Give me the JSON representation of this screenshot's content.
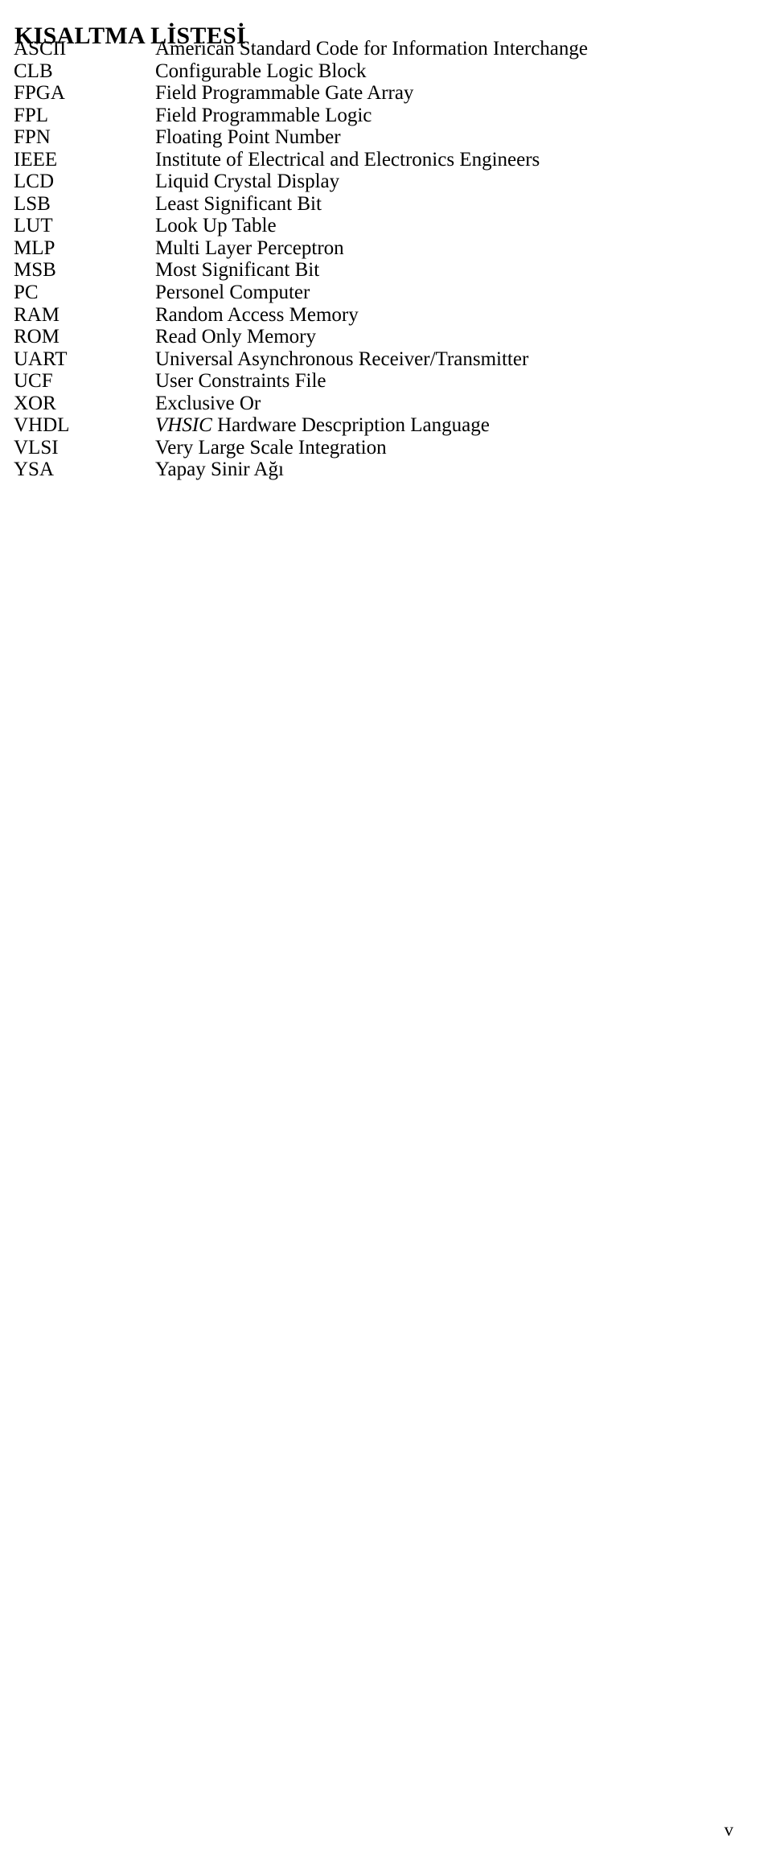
{
  "document": {
    "title": "KISALTMA LİSTESİ",
    "page_number": "v"
  },
  "abbreviations": [
    {
      "term": "ASCII",
      "definition": "American Standard Code for Information Interchange"
    },
    {
      "term": "CLB",
      "definition": "Configurable Logic Block"
    },
    {
      "term": "FPGA",
      "definition": "Field Programmable Gate Array"
    },
    {
      "term": "FPL",
      "definition": "Field Programmable Logic"
    },
    {
      "term": "FPN",
      "definition": "Floating Point Number"
    },
    {
      "term": "IEEE",
      "definition": "Institute of Electrical and Electronics Engineers"
    },
    {
      "term": "LCD",
      "definition": "Liquid Crystal Display"
    },
    {
      "term": "LSB",
      "definition": "Least Significant Bit"
    },
    {
      "term": "LUT",
      "definition": "Look Up Table"
    },
    {
      "term": "MLP",
      "definition": "Multi Layer Perceptron"
    },
    {
      "term": "MSB",
      "definition": "Most Significant Bit"
    },
    {
      "term": "PC",
      "definition": "Personel Computer"
    },
    {
      "term": "RAM",
      "definition": "Random Access Memory"
    },
    {
      "term": "ROM",
      "definition": "Read Only Memory"
    },
    {
      "term": "UART",
      "definition": "Universal Asynchronous Receiver/Transmitter"
    },
    {
      "term": "UCF",
      "definition": "User Constraints File"
    },
    {
      "term": "XOR",
      "definition": "Exclusive Or"
    },
    {
      "term": "VHDL",
      "definition_italic_prefix": "VHSIC",
      "definition": " Hardware Descpription Language"
    },
    {
      "term": "VLSI",
      "definition": "Very Large Scale Integration"
    },
    {
      "term": "YSA",
      "definition": "Yapay Sinir Ağı"
    }
  ]
}
